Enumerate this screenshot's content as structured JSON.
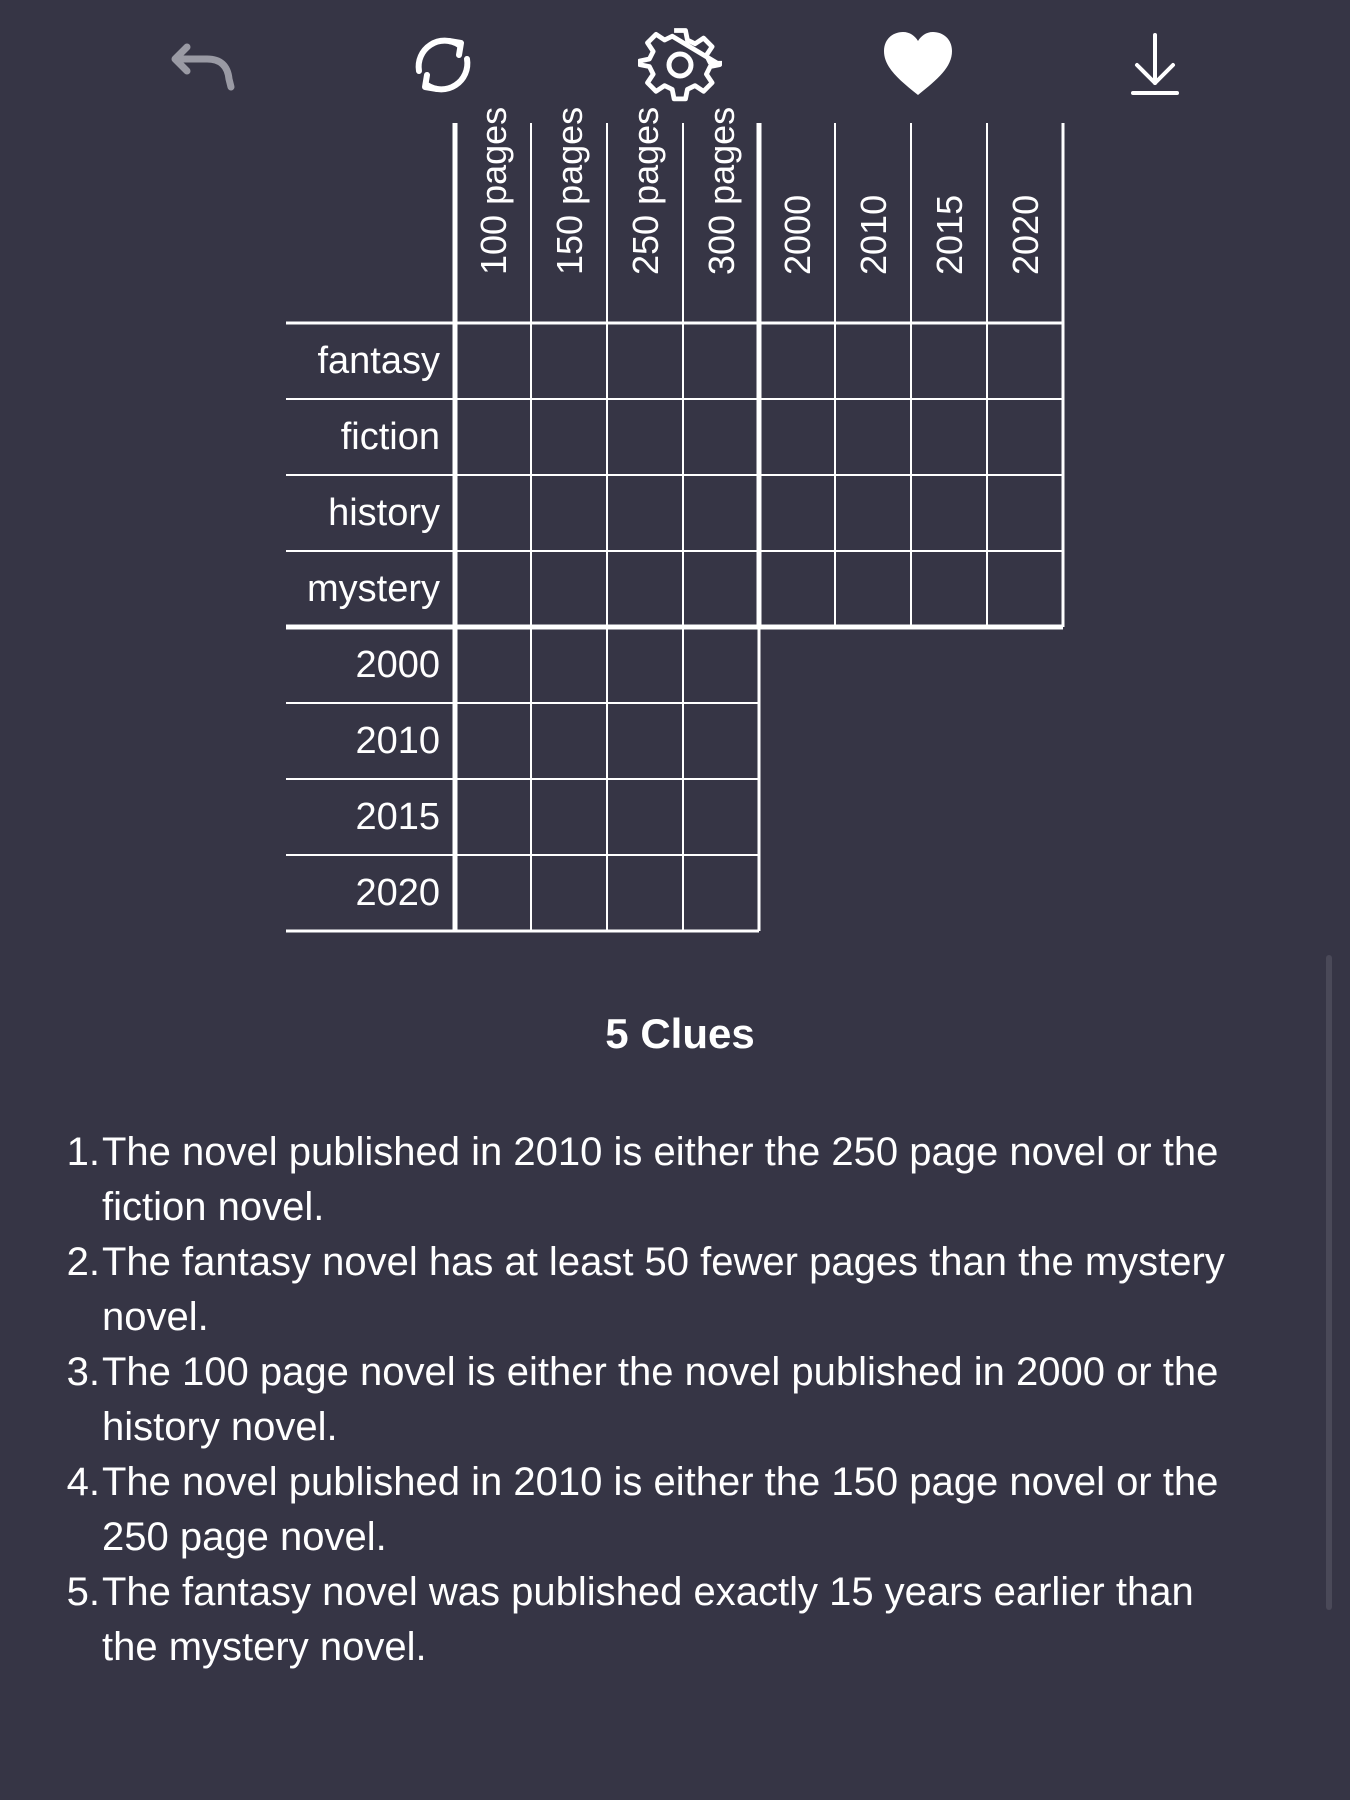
{
  "toolbar": {
    "undo_icon": "undo-arrow-icon",
    "restart_icon": "restart-cycle-icon",
    "settings_icon": "gear-icon",
    "favorite_icon": "heart-icon",
    "download_icon": "download-arrow-icon"
  },
  "grid": {
    "column_groups": [
      [
        "100 pages",
        "150 pages",
        "250 pages",
        "300 pages"
      ],
      [
        "2000",
        "2010",
        "2015",
        "2020"
      ]
    ],
    "row_groups": [
      [
        "fantasy",
        "fiction",
        "history",
        "mystery"
      ],
      [
        "2000",
        "2010",
        "2015",
        "2020"
      ]
    ]
  },
  "clues": {
    "title": "5 Clues",
    "items": [
      {
        "num": "1.",
        "text": "The novel published in 2010 is either the 250 page novel or the fiction novel."
      },
      {
        "num": "2.",
        "text": "The fantasy novel has at least 50 fewer pages than the mystery novel."
      },
      {
        "num": "3.",
        "text": "The 100 page novel is either the novel published in 2000 or the history novel."
      },
      {
        "num": "4.",
        "text": "The novel published in 2010 is either the 150 page novel or the 250 page novel."
      },
      {
        "num": "5.",
        "text": "The fantasy novel was published exactly 15 years earlier than the mystery novel."
      }
    ]
  },
  "colors": {
    "background": "#363545",
    "line": "#ffffff",
    "icon_dim": "#9a9aa4"
  }
}
